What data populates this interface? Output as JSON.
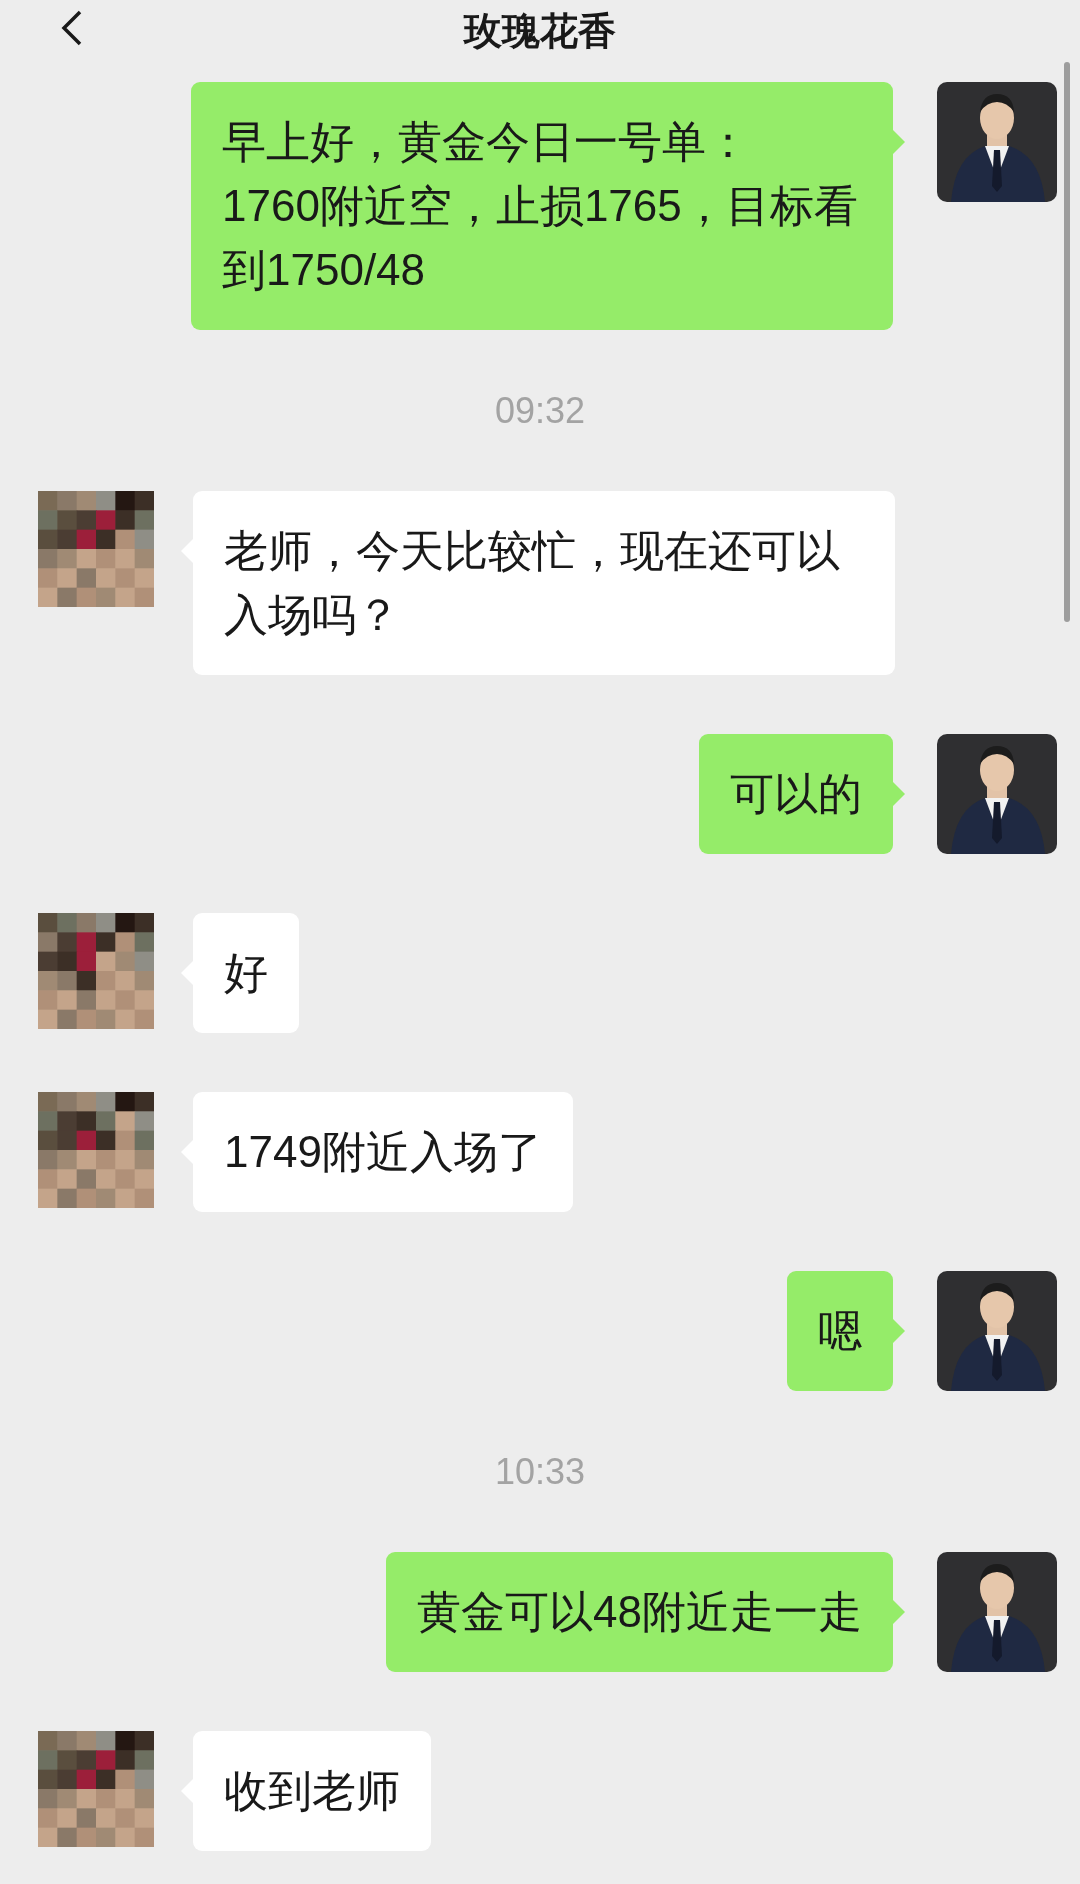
{
  "header": {
    "title": "玫瑰花香"
  },
  "messages": [
    {
      "kind": "sent",
      "text": "早上好，黄金今日一号单：\n1760附近空，止损1765，目标看到1750/48"
    },
    {
      "kind": "time",
      "text": "09:32"
    },
    {
      "kind": "received",
      "text": "老师，今天比较忙，现在还可以入场吗？"
    },
    {
      "kind": "sent",
      "text": "可以的"
    },
    {
      "kind": "received",
      "text": "好"
    },
    {
      "kind": "received",
      "text": "1749附近入场了"
    },
    {
      "kind": "sent",
      "text": "嗯"
    },
    {
      "kind": "time",
      "text": "10:33"
    },
    {
      "kind": "sent",
      "text": "黄金可以48附近走一走"
    },
    {
      "kind": "received",
      "text": "收到老师"
    }
  ]
}
